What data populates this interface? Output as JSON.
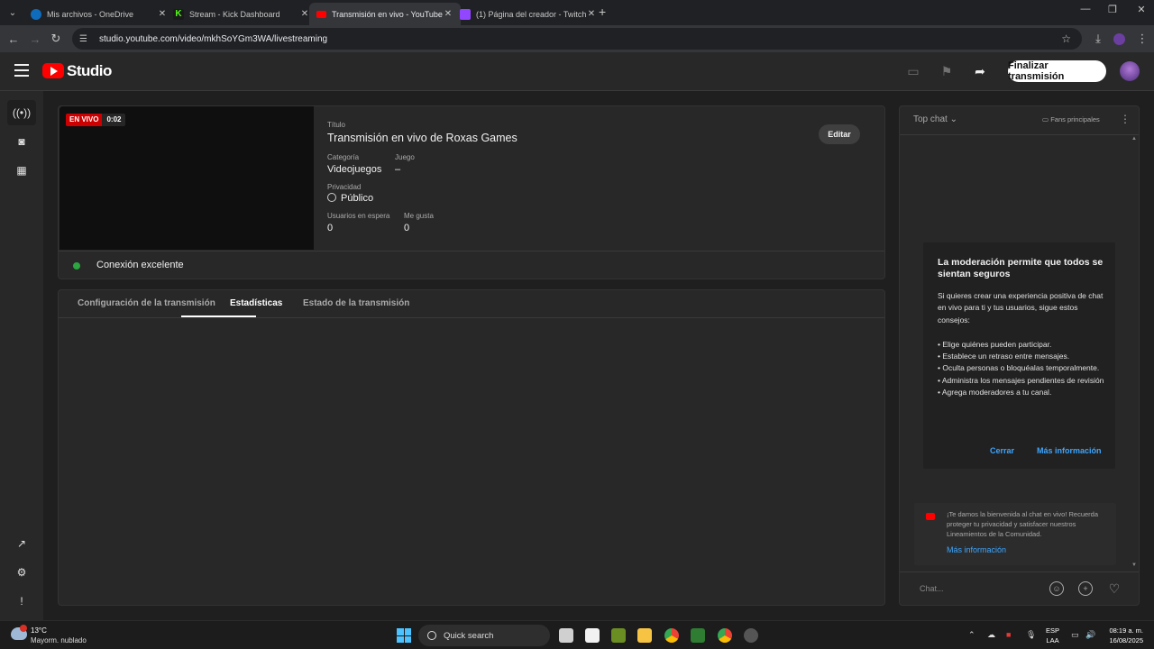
{
  "browser": {
    "tabs": [
      {
        "title": "Mis archivos - OneDrive",
        "favicon_color": "#0f6cbd"
      },
      {
        "title": "Stream - Kick Dashboard",
        "favicon_color": "#53fc18"
      },
      {
        "title": "Transmisión en vivo - YouTube",
        "favicon_color": "#ff0000"
      },
      {
        "title": "(1) Página del creador - Twitch",
        "favicon_color": "#9146ff"
      }
    ],
    "url": "studio.youtube.com/video/mkhSoYGm3WA/livestreaming"
  },
  "header": {
    "brand": "Studio",
    "end_stream_label": "Finalizar transmisión"
  },
  "stream": {
    "live_label": "EN VIVO",
    "elapsed": "0:02",
    "title_label": "Título",
    "title": "Transmisión en vivo de Roxas Games",
    "edit_label": "Editar",
    "category_label": "Categoría",
    "category": "Videojuegos",
    "game_label": "Juego",
    "game": "–",
    "privacy_label": "Privacidad",
    "privacy": "Público",
    "waiting_label": "Usuarios en espera",
    "waiting": "0",
    "likes_label": "Me gusta",
    "likes": "0",
    "connection": "Conexión excelente"
  },
  "tabs": [
    {
      "label": "Configuración de la transmisión"
    },
    {
      "label": "Estadísticas"
    },
    {
      "label": "Estado de la transmisión"
    }
  ],
  "chat": {
    "title": "Top chat",
    "fans_label": "Fans principales",
    "mod_title": "La moderación permite que todos se sientan seguros",
    "mod_intro": "Si quieres crear una experiencia positiva de chat en vivo para ti y tus usuarios, sigue estos consejos:",
    "mod_tips": [
      "• Elige quiénes pueden participar.",
      "• Establece un retraso entre mensajes.",
      "• Oculta personas o bloquéalas temporalmente.",
      "• Administra los mensajes pendientes de revisión",
      "• Agrega moderadores a tu canal."
    ],
    "close_label": "Cerrar",
    "more_label": "Más información",
    "welcome": "¡Te damos la bienvenida al chat en vivo! Recuerda proteger tu privacidad y satisfacer nuestros Lineamientos de la Comunidad.",
    "welcome_link": "Más información",
    "input_placeholder": "Chat..."
  },
  "taskbar": {
    "temp": "13°C",
    "condition": "Mayorm. nublado",
    "search": "Quick search",
    "lang1": "ESP",
    "lang2": "LAA",
    "time": "08:19 a. m.",
    "date": "16/08/2025"
  }
}
